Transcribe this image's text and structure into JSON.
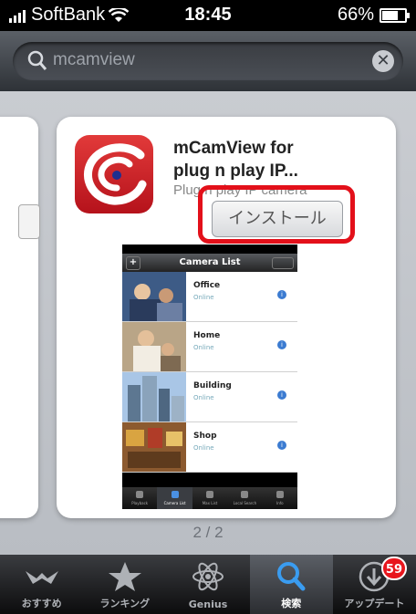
{
  "status_bar": {
    "carrier": "SoftBank",
    "time": "18:45",
    "battery": "66%",
    "battery_level": 0.66
  },
  "search": {
    "query": "mcamview"
  },
  "result": {
    "app_name_line1": "mCamView for",
    "app_name_line2": "plug n play IP...",
    "app_subtitle": "Plug n play IP camera",
    "install_label": "インストール",
    "highlight_color": "#e3101a"
  },
  "screenshot": {
    "title": "Camera List",
    "cameras": [
      {
        "name": "Office",
        "status": "Online"
      },
      {
        "name": "Home",
        "status": "Online"
      },
      {
        "name": "Building",
        "status": "Online"
      },
      {
        "name": "Shop",
        "status": "Online"
      }
    ],
    "tabs": [
      "Playback",
      "Camera List",
      "Max List",
      "Local Search",
      "Info"
    ]
  },
  "pager": "2 / 2",
  "tab_bar": {
    "items": [
      {
        "label": "おすすめ",
        "icon": "featured-icon"
      },
      {
        "label": "ランキング",
        "icon": "star-icon"
      },
      {
        "label": "Genius",
        "icon": "atom-icon"
      },
      {
        "label": "検索",
        "icon": "search-icon"
      },
      {
        "label": "アップデート",
        "icon": "download-icon",
        "badge": "59"
      }
    ],
    "active": "検索"
  }
}
